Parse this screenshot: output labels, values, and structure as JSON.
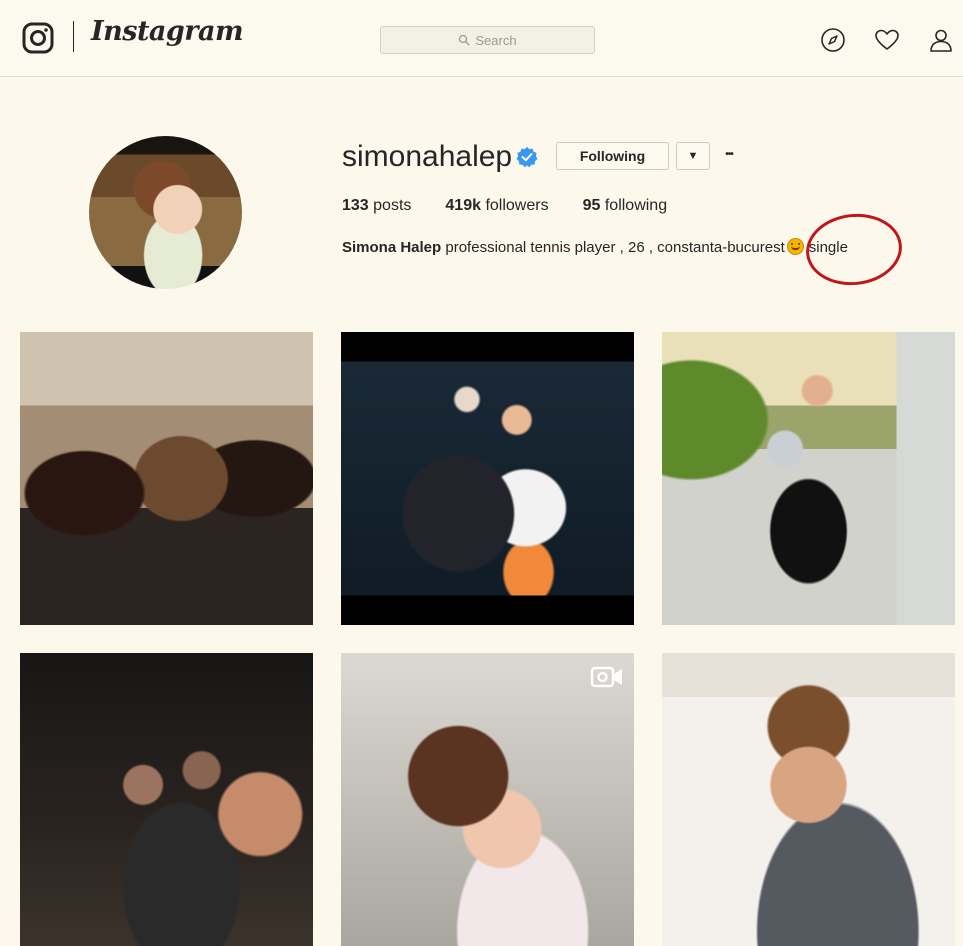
{
  "header": {
    "logo_text": "Instagram",
    "search_placeholder": "Search"
  },
  "profile": {
    "username": "simonahalep",
    "verified": true,
    "follow_button": "Following",
    "dropdown_glyph": "▼",
    "more_glyph": "•••",
    "stats": {
      "posts_count": "133",
      "posts_label": "posts",
      "followers_count": "419k",
      "followers_label": "followers",
      "following_count": "95",
      "following_label": "following"
    },
    "bio": {
      "name": "Simona Halep",
      "text": "professional tennis player , 26 , constanta-bucurest",
      "emoji": "smiley",
      "suffix": "single"
    }
  },
  "posts": [
    {
      "index": 1,
      "type": "photo"
    },
    {
      "index": 2,
      "type": "photo"
    },
    {
      "index": 3,
      "type": "photo"
    },
    {
      "index": 4,
      "type": "photo"
    },
    {
      "index": 5,
      "type": "video"
    },
    {
      "index": 6,
      "type": "photo"
    }
  ],
  "colors": {
    "background": "#fcf8ec",
    "verified_badge": "#3897f0",
    "annotation_circle": "#c0161c"
  }
}
